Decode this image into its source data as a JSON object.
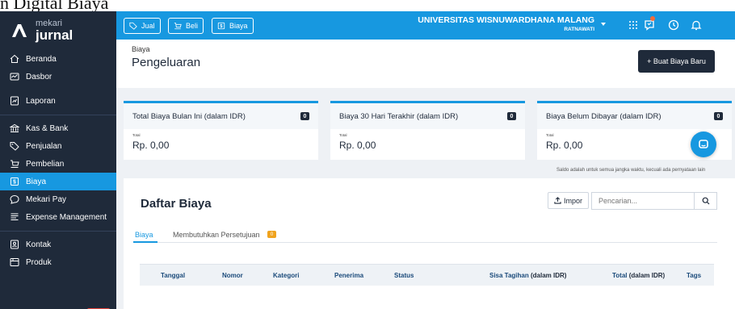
{
  "doc_caption": "n Digital Biaya",
  "sidebar": {
    "logo_small": "mekari",
    "logo_big": "jurnal",
    "items": [
      {
        "label": "Beranda",
        "icon": "home-icon"
      },
      {
        "label": "Dasbor",
        "icon": "dashboard-icon"
      },
      {
        "label": "Laporan",
        "icon": "report-icon"
      },
      {
        "label": "Kas & Bank",
        "icon": "bank-icon"
      },
      {
        "label": "Penjualan",
        "icon": "tag-icon"
      },
      {
        "label": "Pembelian",
        "icon": "cart-icon"
      },
      {
        "label": "Biaya",
        "icon": "expense-icon",
        "active": true
      },
      {
        "label": "Mekari Pay",
        "icon": "chat-pay-icon"
      },
      {
        "label": "Expense Management",
        "icon": "expense-management-icon"
      },
      {
        "label": "Kontak",
        "icon": "contact-icon"
      },
      {
        "label": "Produk",
        "icon": "product-icon"
      }
    ]
  },
  "topbar": {
    "buttons": [
      {
        "label": "Jual",
        "icon": "tag-icon"
      },
      {
        "label": "Beli",
        "icon": "cart-icon"
      },
      {
        "label": "Biaya",
        "icon": "expense-icon"
      }
    ],
    "company": "UNIVERSITAS WISNUWARDHANA MALANG",
    "user": "RATNAWATI",
    "icons": [
      "apps-grid-icon",
      "notification-icon",
      "clock-icon",
      "bell-icon"
    ]
  },
  "page": {
    "breadcrumb": "Biaya",
    "title": "Pengeluaran",
    "new_button": "+ Buat Biaya Baru"
  },
  "cards": [
    {
      "title": "Total Biaya Bulan Ini (dalam IDR)",
      "badge": "0",
      "total_label": "Total",
      "value": "Rp. 0,00"
    },
    {
      "title": "Biaya 30 Hari Terakhir (dalam IDR)",
      "badge": "0",
      "total_label": "Total",
      "value": "Rp. 0,00"
    },
    {
      "title": "Biaya Belum Dibayar (dalam IDR)",
      "badge": "0",
      "total_label": "Total",
      "value": "Rp. 0,00"
    }
  ],
  "footnote": "Saldo adalah untuk semua jangka waktu, kecuali ada pernyataan lain",
  "panel": {
    "title": "Daftar Biaya",
    "import_label": "Impor",
    "search_placeholder": "Pencarian...",
    "tabs": [
      {
        "label": "Biaya",
        "active": true
      },
      {
        "label": "Membutuhkan Persetujuan",
        "count": "0"
      }
    ],
    "columns": [
      {
        "label": "Tanggal"
      },
      {
        "label": "Nomor"
      },
      {
        "label": "Kategori"
      },
      {
        "label": "Penerima"
      },
      {
        "label": "Status"
      },
      {
        "label": "Sisa Tagihan",
        "unit": "(dalam IDR)"
      },
      {
        "label": "Total",
        "unit": "(dalam IDR)"
      },
      {
        "label": "Tags"
      }
    ]
  },
  "colors": {
    "primary": "#1798e0",
    "navy": "#1f2a3a",
    "badge_orange": "#f0a31e",
    "alert_red": "#e8453c"
  }
}
